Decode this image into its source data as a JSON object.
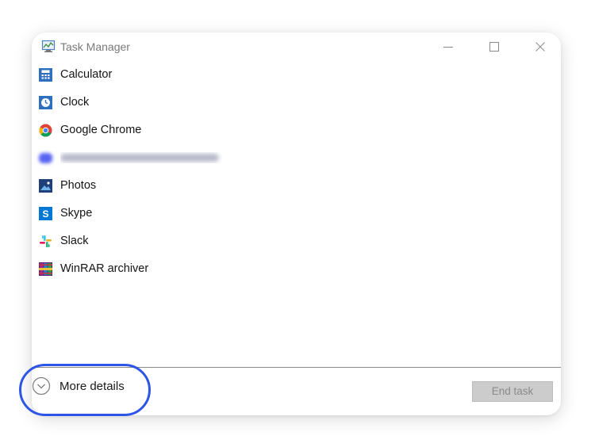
{
  "window": {
    "title": "Task Manager",
    "icon": "task-manager-icon",
    "controls": [
      "minimize-icon",
      "maximize-icon",
      "close-icon"
    ]
  },
  "apps": [
    {
      "label": "Calculator",
      "icon": "calculator-icon",
      "color": "#2f6fc0"
    },
    {
      "label": "Clock",
      "icon": "clock-icon",
      "color": "#2f6fc0"
    },
    {
      "label": "Google Chrome",
      "icon": "chrome-icon",
      "color": "#4285f4"
    },
    {
      "label": "",
      "icon": "blurred-app-icon",
      "color": "#5865f2"
    },
    {
      "label": "Photos",
      "icon": "photos-icon",
      "color": "#1f4fa0"
    },
    {
      "label": "Skype",
      "icon": "skype-icon",
      "color": "#0078d4"
    },
    {
      "label": "Slack",
      "icon": "slack-icon",
      "color": "#e01e5a"
    },
    {
      "label": "WinRAR archiver",
      "icon": "winrar-icon",
      "color": "#a0288c"
    }
  ],
  "footer": {
    "more_details_label": "More details",
    "more_details_icon": "chevron-down-circle-icon",
    "end_task_label": "End task"
  },
  "colors": {
    "highlight": "#2e56e6",
    "disabled_button": "#cccccc"
  }
}
